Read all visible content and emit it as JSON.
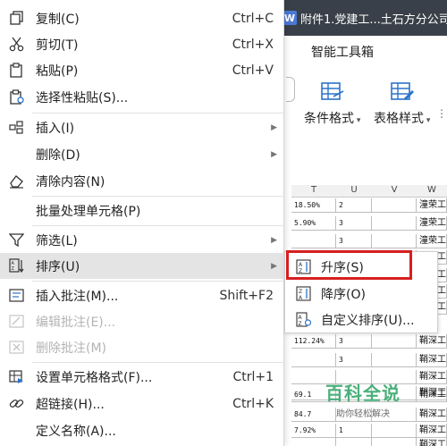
{
  "app": {
    "doc_tab_label": "附件1.党建工...土石方分公司",
    "doc_tab_icon": "W",
    "ribbon_tab": "智能工具箱",
    "ribbon_buttons": [
      {
        "label": "条件格式",
        "icon": "conditional-format-icon"
      },
      {
        "label": "表格样式",
        "icon": "table-style-icon"
      }
    ]
  },
  "sheet": {
    "columns": [
      "T",
      "U",
      "V",
      "W"
    ],
    "rows": [
      {
        "t": "18.50%",
        "u": "2",
        "v": "",
        "w": "潼荣工"
      },
      {
        "t": "5.90%",
        "u": "3",
        "v": "",
        "w": "潼荣工"
      },
      {
        "t": "",
        "u": "3",
        "v": "",
        "w": "潼荣工"
      },
      {
        "t": "",
        "u": "",
        "v": "",
        "w": "潼荣工"
      },
      {
        "t": "",
        "u": "",
        "v": "",
        "w": "潼荣工"
      },
      {
        "t": "",
        "u": "",
        "v": "",
        "w": "潼荣工"
      },
      {
        "t": "",
        "u": "",
        "v": "",
        "w": "潼荣工"
      },
      {
        "t": "112.24%",
        "u": "3",
        "v": "",
        "w": "鞘深工"
      },
      {
        "t": "",
        "u": "3",
        "v": "",
        "w": "鞘深工"
      },
      {
        "t": "",
        "u": "",
        "v": "",
        "w": "鞘深工"
      },
      {
        "t": "",
        "u": "",
        "v": "",
        "w": "鞘深工"
      },
      {
        "t": "69.1",
        "u": "",
        "v": "",
        "w": "鞘深工"
      },
      {
        "t": "84.7",
        "u": "",
        "v": "",
        "w": "鞘深工"
      },
      {
        "t": "7.92%",
        "u": "1",
        "v": "",
        "w": "鞘深工"
      },
      {
        "t": "",
        "u": "",
        "v": "",
        "w": "鞘深工"
      }
    ]
  },
  "context_menu": {
    "items": [
      {
        "label": "复制(C)",
        "shortcut": "Ctrl+C",
        "icon": "copy-icon",
        "disabled": false
      },
      {
        "label": "剪切(T)",
        "shortcut": "Ctrl+X",
        "icon": "scissors-icon",
        "disabled": false
      },
      {
        "label": "粘贴(P)",
        "shortcut": "Ctrl+V",
        "icon": "paste-icon",
        "disabled": false
      },
      {
        "label": "选择性粘贴(S)...",
        "shortcut": "",
        "icon": "paste-special-icon",
        "disabled": false
      },
      {
        "label": "插入(I)",
        "shortcut": "",
        "icon": "insert-icon",
        "disabled": false,
        "submenu": true
      },
      {
        "label": "删除(D)",
        "shortcut": "",
        "icon": "",
        "disabled": false,
        "submenu": true
      },
      {
        "label": "清除内容(N)",
        "shortcut": "",
        "icon": "eraser-icon",
        "disabled": false
      },
      {
        "label": "批量处理单元格(P)",
        "shortcut": "",
        "icon": "",
        "disabled": false
      },
      {
        "label": "筛选(L)",
        "shortcut": "",
        "icon": "filter-icon",
        "disabled": false,
        "submenu": true
      },
      {
        "label": "排序(U)",
        "shortcut": "",
        "icon": "sort-icon",
        "disabled": false,
        "submenu": true,
        "highlighted": true
      },
      {
        "label": "插入批注(M)...",
        "shortcut": "Shift+F2",
        "icon": "insert-comment-icon",
        "disabled": false
      },
      {
        "label": "编辑批注(E)...",
        "shortcut": "",
        "icon": "edit-comment-icon",
        "disabled": true
      },
      {
        "label": "删除批注(M)",
        "shortcut": "",
        "icon": "delete-comment-icon",
        "disabled": true
      },
      {
        "label": "设置单元格格式(F)...",
        "shortcut": "Ctrl+1",
        "icon": "format-cells-icon",
        "disabled": false
      },
      {
        "label": "超链接(H)...",
        "shortcut": "Ctrl+K",
        "icon": "link-icon",
        "disabled": false
      },
      {
        "label": "定义名称(A)...",
        "shortcut": "",
        "icon": "",
        "disabled": false
      }
    ]
  },
  "sort_submenu": {
    "items": [
      {
        "label": "升序(S)",
        "icon": "sort-ascending-icon",
        "highlighted_red": true
      },
      {
        "label": "降序(O)",
        "icon": "sort-descending-icon"
      },
      {
        "label": "自定义排序(U)...",
        "icon": "custom-sort-icon"
      }
    ]
  },
  "watermark": {
    "title": "百科全说",
    "subtitle": "助你轻松解决"
  },
  "colors": {
    "highlight_border": "#d61f1f",
    "menu_hover": "#e4e4e4",
    "watermark_green": "#4ab07a",
    "icon_blue": "#2b73c9"
  }
}
